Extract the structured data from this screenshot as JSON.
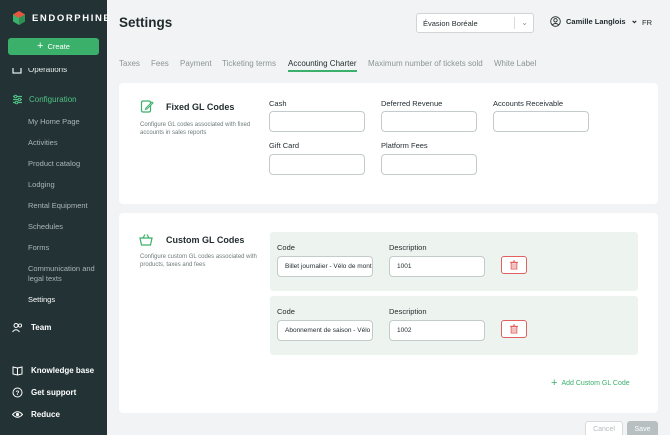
{
  "sidebar": {
    "brand": "ENDORPHINE",
    "create_label": "Create",
    "operations_label": "Operations",
    "configuration_label": "Configuration",
    "sub_items": [
      {
        "label": "My Home Page",
        "active": false
      },
      {
        "label": "Activities",
        "active": false
      },
      {
        "label": "Product catalog",
        "active": false
      },
      {
        "label": "Lodging",
        "active": false
      },
      {
        "label": "Rental Equipment",
        "active": false
      },
      {
        "label": "Schedules",
        "active": false
      },
      {
        "label": "Forms",
        "active": false
      },
      {
        "label": "Communication and legal texts",
        "active": false
      },
      {
        "label": "Settings",
        "active": true
      }
    ],
    "team_label": "Team",
    "knowledge_base_label": "Knowledge base",
    "support_label": "Get support",
    "reduce_label": "Reduce"
  },
  "header": {
    "title": "Settings",
    "organization": "Évasion Boréale",
    "user_name": "Camille Langlois",
    "language": "FR"
  },
  "tabs": [
    {
      "label": "Taxes",
      "active": false
    },
    {
      "label": "Fees",
      "active": false
    },
    {
      "label": "Payment",
      "active": false
    },
    {
      "label": "Ticketing terms",
      "active": false
    },
    {
      "label": "Accounting Charter",
      "active": true
    },
    {
      "label": "Maximum number of tickets sold",
      "active": false
    },
    {
      "label": "White Label",
      "active": false
    }
  ],
  "fixed_gl": {
    "title": "Fixed GL Codes",
    "description": "Configure GL codes associated with fixed accounts in sales reports",
    "fields": [
      {
        "label": "Cash",
        "value": ""
      },
      {
        "label": "Deferred Revenue",
        "value": ""
      },
      {
        "label": "Accounts Receivable",
        "value": ""
      },
      {
        "label": "Gift Card",
        "value": ""
      },
      {
        "label": "Platform Fees",
        "value": ""
      }
    ]
  },
  "custom_gl": {
    "title": "Custom GL Codes",
    "description": "Configure custom GL codes associated with products, taxes and fees",
    "code_label": "Code",
    "description_label": "Description",
    "rows": [
      {
        "code": "Billet journalier - Vélo de montagne",
        "description": "1001"
      },
      {
        "code": "Abonnement de saison - Vélo de montagne",
        "description": "1002"
      }
    ],
    "add_label": "Add Custom GL Code"
  },
  "footer": {
    "cancel_label": "Cancel",
    "save_label": "Save"
  },
  "colors": {
    "sidebar_bg": "#233235",
    "accent_green": "#3ab06b",
    "delete_red": "#e06060"
  }
}
